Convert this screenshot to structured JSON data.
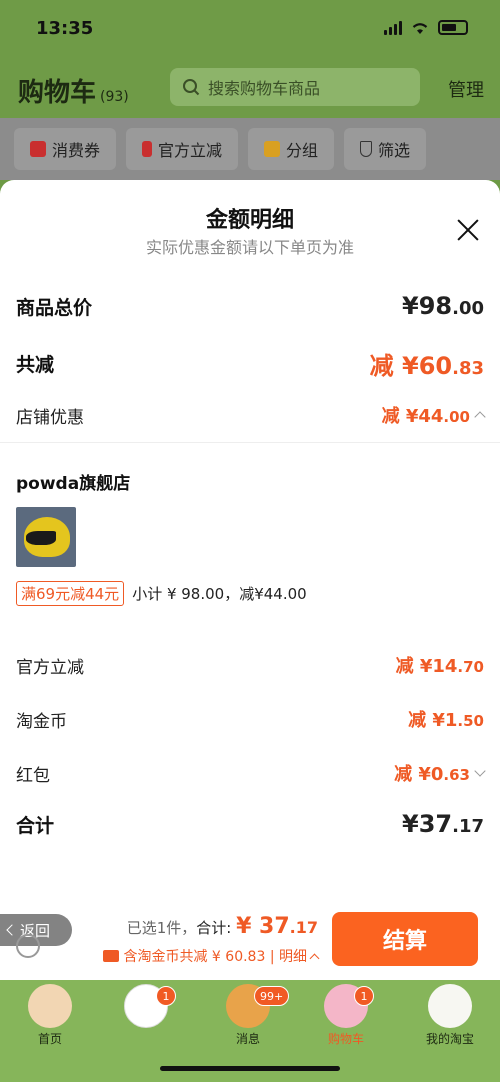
{
  "status": {
    "time": "13:35"
  },
  "header": {
    "title": "购物车",
    "count": "(93)",
    "search_placeholder": "搜索购物车商品",
    "manage": "管理"
  },
  "filters": [
    "消费券",
    "官方立减",
    "分组",
    "筛选"
  ],
  "sheet": {
    "title": "金额明细",
    "subtitle": "实际优惠金额请以下单页为准",
    "total_price": {
      "label": "商品总价",
      "int": "¥98",
      "dec": ".00"
    },
    "total_discount": {
      "label": "共减",
      "int": "减 ¥60",
      "dec": ".83"
    },
    "store_discount": {
      "label": "店铺优惠",
      "int": "减 ¥44",
      "dec": ".00"
    },
    "store": {
      "name": "powda旗舰店",
      "promo_tag": "满69元减44元",
      "promo_text": "小计 ¥ 98.00，减¥44.00"
    },
    "official_discount": {
      "label": "官方立减",
      "int": "减 ¥14",
      "dec": ".70"
    },
    "coins": {
      "label": "淘金币",
      "int": "减 ¥1",
      "dec": ".50"
    },
    "red_packet": {
      "label": "红包",
      "int": "减 ¥0",
      "dec": ".63"
    },
    "grand_total": {
      "label": "合计",
      "int": "¥37",
      "dec": ".17"
    }
  },
  "checkout": {
    "back": "返回",
    "selected": "已选1件，",
    "total_label": "合计: ",
    "total_int": "¥ 37",
    "total_dec": ".17",
    "subsidy": "含淘金币共减 ¥ 60.83 | 明细",
    "pay": "结算"
  },
  "tabs": [
    {
      "label": "首页",
      "badge": ""
    },
    {
      "label": "",
      "badge": "1"
    },
    {
      "label": "消息",
      "badge": "99+"
    },
    {
      "label": "购物车",
      "badge": "1"
    },
    {
      "label": "我的淘宝",
      "badge": ""
    }
  ],
  "colors": {
    "accent": "#ef5a25",
    "header_green": "#6f9b47"
  }
}
